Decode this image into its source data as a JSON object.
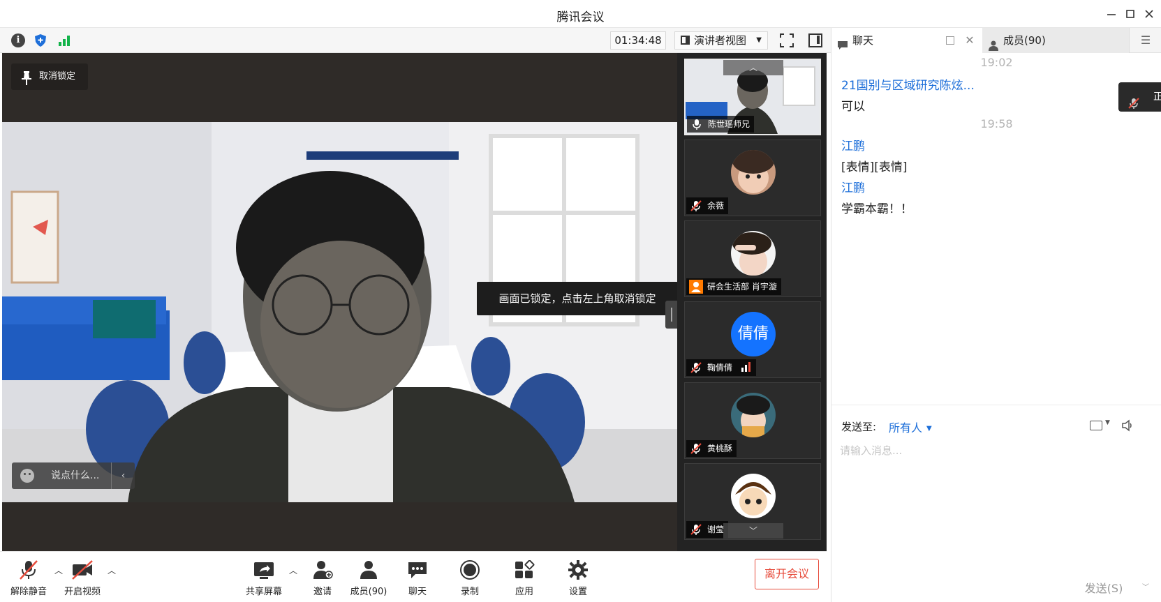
{
  "window": {
    "title": "腾讯会议"
  },
  "toolbar": {
    "timer": "01:34:48",
    "view_mode": "演讲者视图"
  },
  "stage": {
    "unlock_label": "取消锁定",
    "lock_tip": "画面已锁定，点击左上角取消锁定",
    "chat_bubble_placeholder": "说点什么..."
  },
  "participants": [
    {
      "name": "陈世瑶师兄",
      "muted": false,
      "active": true,
      "avatar": "video-thumb"
    },
    {
      "name": "余薇",
      "muted": true,
      "avatar": "photo-avatar"
    },
    {
      "name": "研会生活部 肖宇漩",
      "muted": false,
      "avatar": "photo-avatar",
      "badge": "person-icon"
    },
    {
      "name": "鞠倩倩",
      "muted": true,
      "avatar_text": "倩倩",
      "signal": true
    },
    {
      "name": "黄桃酥",
      "muted": true,
      "avatar": "photo-avatar"
    },
    {
      "name": "谢莹",
      "muted": true,
      "avatar": "cartoon-avatar"
    }
  ],
  "controls": {
    "unmute": "解除静音",
    "start_video": "开启视频",
    "share_screen": "共享屏幕",
    "invite": "邀请",
    "members": "成员(90)",
    "chat": "聊天",
    "record": "录制",
    "apps": "应用",
    "settings": "设置",
    "leave": "离开会议"
  },
  "chat_panel": {
    "tab_chat": "聊天",
    "tab_members": "成员(90)",
    "messages": [
      {
        "time": "19:02"
      },
      {
        "sender": "21国别与区域研究陈炫...",
        "text": "可以"
      },
      {
        "time": "19:58"
      },
      {
        "sender": "江鹏",
        "text": "[表情][表情]"
      },
      {
        "sender": "江鹏",
        "text": "学霸本霸！！"
      }
    ],
    "speaking_toast": "正在讲话",
    "send_to_label": "发送至:",
    "send_to_value": "所有人",
    "input_placeholder": "请输入消息...",
    "send_button": "发送(S)"
  },
  "colors": {
    "accent_blue": "#1e6fd9",
    "leave_red": "#e74c3c",
    "stage_bg": "#2f2b28",
    "strip_bg": "#232323"
  }
}
